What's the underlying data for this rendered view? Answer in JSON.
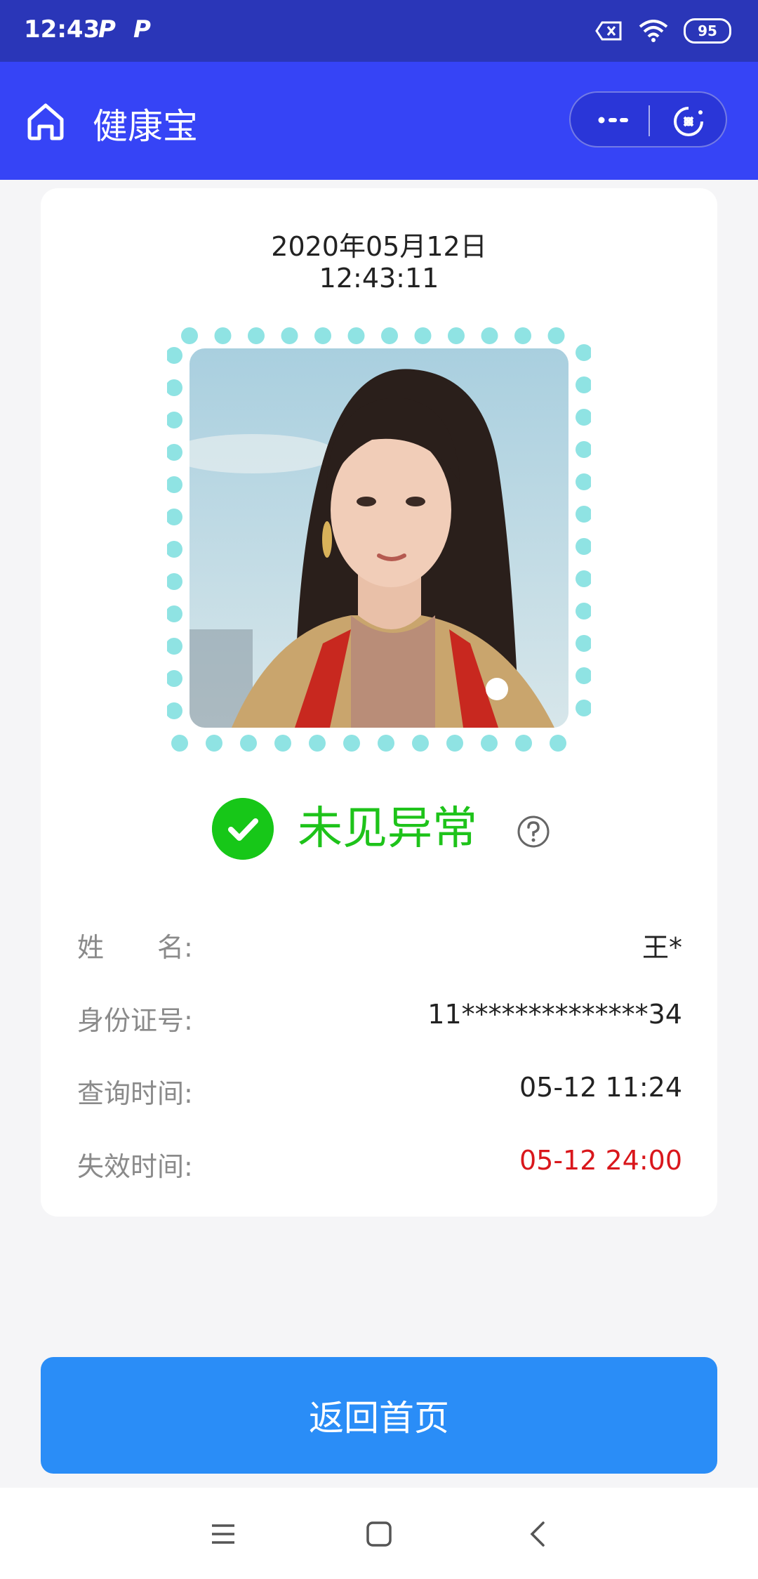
{
  "status_bar": {
    "time": "12:43",
    "notif_1": "P",
    "notif_2": "P",
    "battery": "95",
    "icons": [
      "sim-off-icon",
      "wifi-icon",
      "battery-icon"
    ]
  },
  "header": {
    "title": "健康宝",
    "icons": [
      "home-icon",
      "more-icon",
      "close-icon"
    ]
  },
  "card": {
    "date": "2020年05月12日",
    "time": "12:43:11",
    "status": "未见异常",
    "status_color": "#1ec31a",
    "fields": [
      {
        "label": "姓　　名:",
        "value": "王*"
      },
      {
        "label": "身份证号:",
        "value": "11**************34"
      },
      {
        "label": "查询时间:",
        "value": "05-12 11:24"
      },
      {
        "label": "失效时间:",
        "value": "05-12 24:00",
        "value_color": "#d9171c"
      }
    ]
  },
  "back_button": {
    "label": "返回首页"
  },
  "nav_bar": {
    "icons": [
      "menu-icon",
      "home-square-icon",
      "back-icon"
    ]
  },
  "colors": {
    "status_bar": "#2a36b8",
    "header": "#3644f6",
    "button": "#2a8df7",
    "dots": "#8fe3e3"
  }
}
